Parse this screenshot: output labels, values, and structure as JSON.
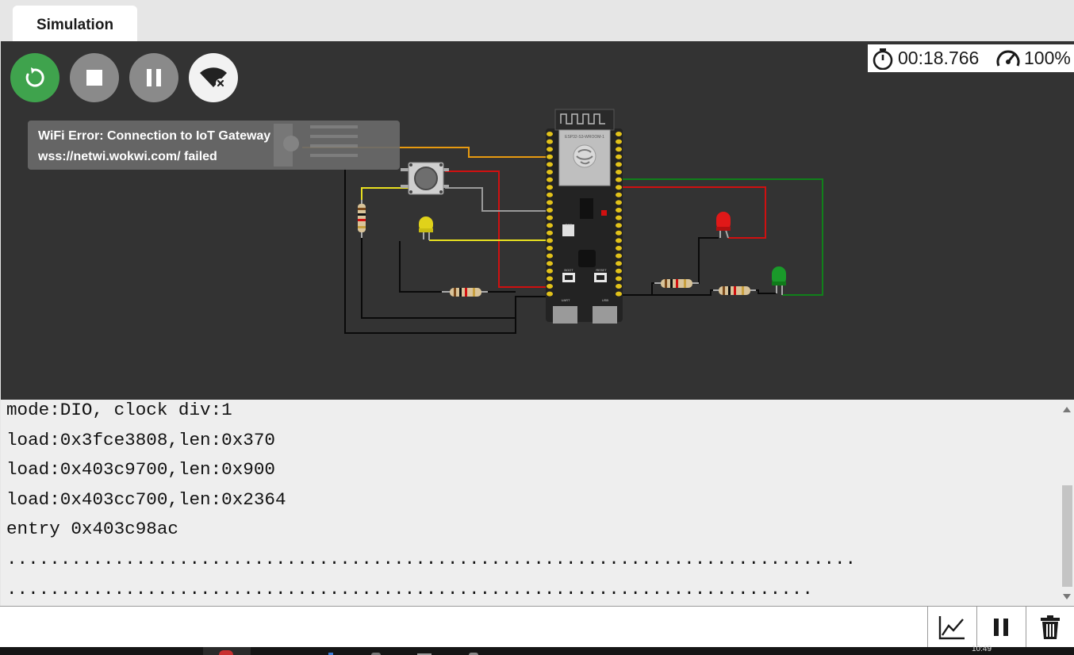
{
  "tabs": [
    {
      "label": "Simulation"
    }
  ],
  "controls": {
    "restart": "restart-icon",
    "stop": "stop-icon",
    "pause": "pause-icon",
    "wifi": "wifi-off-icon"
  },
  "status": {
    "elapsed": "00:18.766",
    "speed": "100%"
  },
  "wifi_error": {
    "line1": "WiFi Error: Connection to IoT Gateway",
    "line2": "wss://netwi.wokwi.com/ failed"
  },
  "board": {
    "module_label": "ESP32-S3-WROOM-1",
    "boot_label": "BOOT",
    "reset_label": "RESET",
    "usb1_label": "UART",
    "usb2_label": "USB",
    "rgb_label": "RGB"
  },
  "colors": {
    "restart": "#3fa34d",
    "wire_red": "#d01010",
    "wire_green": "#10801a",
    "wire_yellow": "#e8e020",
    "wire_orange": "#e89a10",
    "wire_gray": "#9a9a9a",
    "wire_black": "#0a0a0a"
  },
  "serial": {
    "lines": [
      "mode:DIO, clock div:1",
      "load:0x3fce3808,len:0x370",
      "load:0x403c9700,len:0x900",
      "load:0x403cc700,len:0x2364",
      "entry 0x403c98ac",
      "...............................................................................",
      "..........................................................................."
    ],
    "input_value": ""
  },
  "serial_toolbar": {
    "plot": "chart-icon",
    "pause": "pause-icon",
    "clear": "trash-icon"
  },
  "taskbar": {
    "clock": "10:49"
  }
}
